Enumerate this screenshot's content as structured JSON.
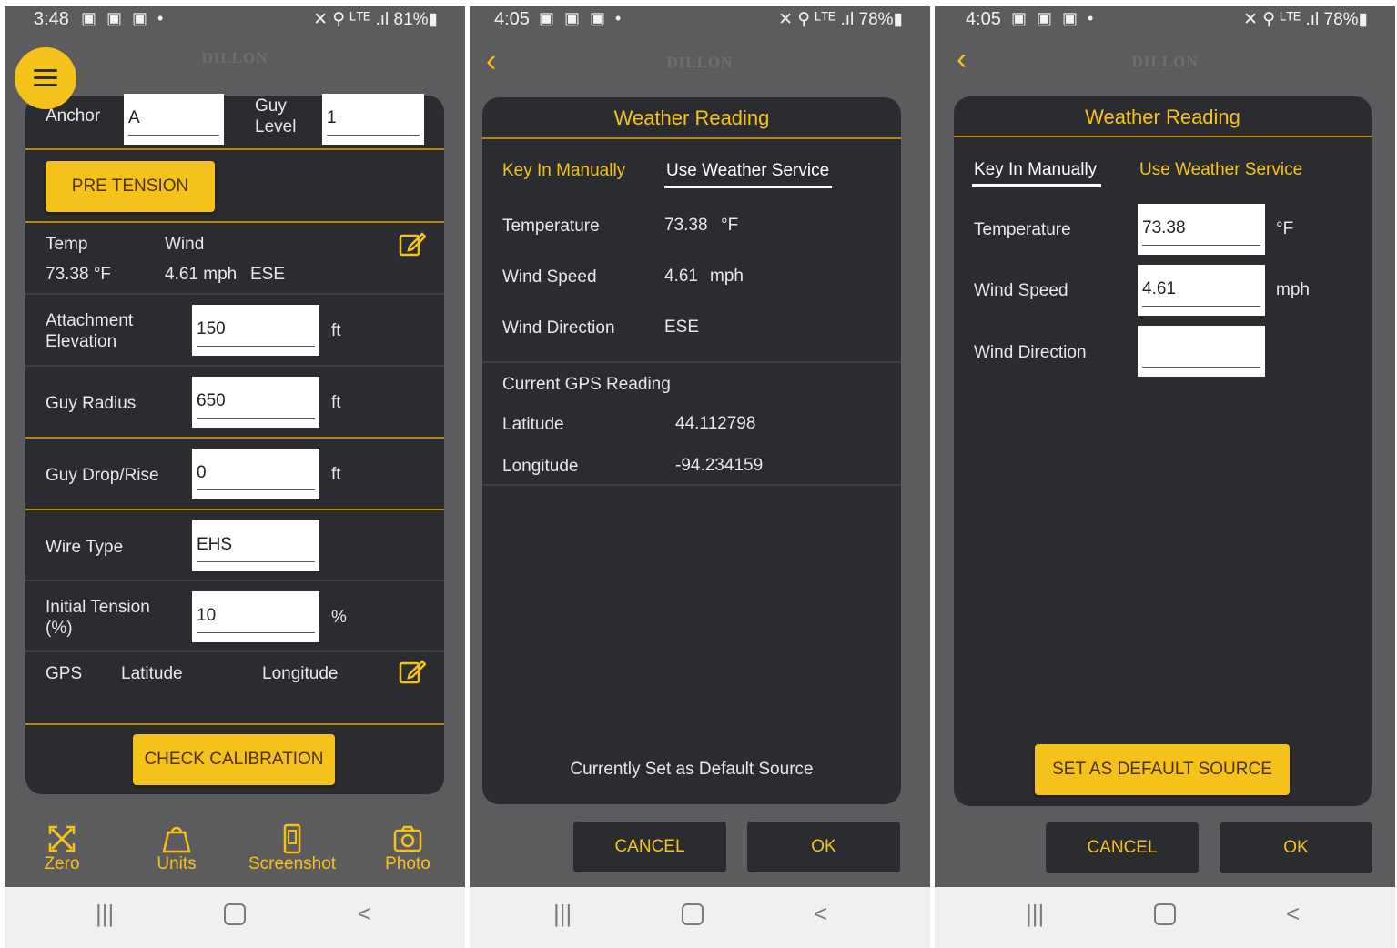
{
  "colors": {
    "accent": "#f5c21b",
    "card": "#2b2c30",
    "background": "#5c5c5e"
  },
  "brand": "DILLON",
  "screen1": {
    "status": {
      "time": "3:48",
      "notif": "▣ ▣ ▣  •",
      "sys": "✕ ⚲ ᴸᵀᴱ .ıl 81%▮"
    },
    "anchor_label": "Anchor",
    "anchor_value": "A",
    "guy_level_label": "Guy Level",
    "guy_level_value": "1",
    "pretension_label": "PRE TENSION",
    "temp_label": "Temp",
    "wind_label": "Wind",
    "temp_value": "73.38 °F",
    "wind_value": "4.61 mph",
    "wind_dir": "ESE",
    "attachment_label": "Attachment Elevation",
    "attachment_value": "150",
    "attachment_unit": "ft",
    "guy_radius_label": "Guy Radius",
    "guy_radius_value": "650",
    "guy_radius_unit": "ft",
    "guy_drop_label": "Guy Drop/Rise",
    "guy_drop_value": "0",
    "guy_drop_unit": "ft",
    "wire_type_label": "Wire Type",
    "wire_type_value": "EHS",
    "initial_tension_label": "Initial Tension (%)",
    "initial_tension_value": "10",
    "initial_tension_unit": "%",
    "gps_label": "GPS",
    "latitude_label": "Latitude",
    "longitude_label": "Longitude",
    "check_calibration_label": "CHECK CALIBRATION",
    "nav": [
      {
        "label": "Zero",
        "icon": "zero-icon"
      },
      {
        "label": "Units",
        "icon": "units-icon"
      },
      {
        "label": "Screenshot",
        "icon": "screenshot-icon"
      },
      {
        "label": "Photo",
        "icon": "camera-icon"
      }
    ]
  },
  "screen2": {
    "status": {
      "time": "4:05",
      "notif": "▣ ▣ ▣  •",
      "sys": "✕ ⚲ ᴸᵀᴱ .ıl 78%▮"
    },
    "title": "Weather Reading",
    "tab_manual": "Key In Manually",
    "tab_service": "Use Weather Service",
    "temperature_label": "Temperature",
    "temperature_value": "73.38",
    "temperature_unit": "°F",
    "wind_speed_label": "Wind Speed",
    "wind_speed_value": "4.61",
    "wind_speed_unit": "mph",
    "wind_direction_label": "Wind Direction",
    "wind_direction_value": "ESE",
    "gps_heading": "Current GPS Reading",
    "latitude_label": "Latitude",
    "latitude_value": "44.112798",
    "longitude_label": "Longitude",
    "longitude_value": "-94.234159",
    "default_note": "Currently Set as Default Source",
    "cancel_label": "CANCEL",
    "ok_label": "OK"
  },
  "screen3": {
    "status": {
      "time": "4:05",
      "notif": "▣ ▣ ▣  •",
      "sys": "✕ ⚲ ᴸᵀᴱ .ıl 78%▮"
    },
    "title": "Weather Reading",
    "tab_manual": "Key In Manually",
    "tab_service": "Use Weather Service",
    "temperature_label": "Temperature",
    "temperature_value": "73.38",
    "temperature_unit": "°F",
    "wind_speed_label": "Wind Speed",
    "wind_speed_value": "4.61",
    "wind_speed_unit": "mph",
    "wind_direction_label": "Wind Direction",
    "wind_direction_value": "",
    "set_default_label": "SET AS DEFAULT SOURCE",
    "cancel_label": "CANCEL",
    "ok_label": "OK"
  }
}
